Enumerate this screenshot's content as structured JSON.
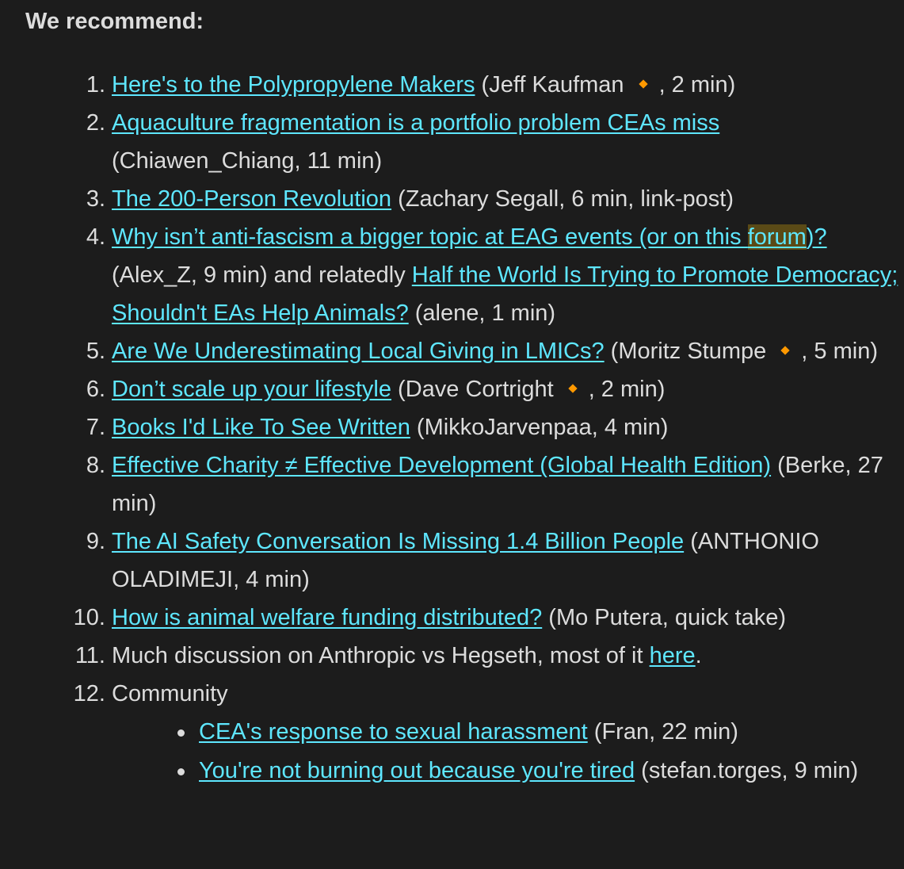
{
  "heading": "We recommend:",
  "items": [
    {
      "num": "1.",
      "title": "Here's to the Polypropylene Makers",
      "author": "Jeff Kaufman",
      "after": ", 2 min)"
    },
    {
      "num": "2.",
      "title": "Aquaculture fragmentation is a portfolio problem CEAs miss",
      "meta": "(Chiawen_Chiang, 11 min)"
    },
    {
      "num": "3.",
      "title": "The 200-Person Revolution",
      "meta": "(Zachary Segall, 6 min, link-post)"
    },
    {
      "num": "4.",
      "title_a": "Why isn’t anti-fascism a bigger topic at EAG events (or on this ",
      "title_hl": "forum",
      "title_b": ")?",
      "meta": "(Alex_Z, 9 min) and relatedly",
      "title2": "Half the World Is Trying to Promote Democracy; Shouldn't EAs Help Animals?",
      "meta2": "(alene, 1 min)"
    },
    {
      "num": "5.",
      "title": "Are We Underestimating Local Giving in LMICs?",
      "author": "Moritz Stumpe",
      "after": ", 5 min)"
    },
    {
      "num": "6.",
      "title": "Don’t scale up your lifestyle",
      "author": "Dave Cortright",
      "after": ", 2 min)"
    },
    {
      "num": "7.",
      "title": "Books I'd Like To See Written",
      "meta": "(MikkoJarvenpaa, 4 min)"
    },
    {
      "num": "8.",
      "title": "Effective Charity ≠ Effective Development (Global Health Edition)",
      "meta": "(Berke, 27 min)"
    },
    {
      "num": "9.",
      "title": "The AI Safety Conversation Is Missing 1.4 Billion People",
      "meta": "(ANTHONIO OLADIMEJI, 4 min)"
    },
    {
      "num": "10.",
      "title": "How is animal welfare funding distributed?",
      "meta": "(Mo Putera, quick take)"
    },
    {
      "num": "11.",
      "text": "Much discussion on Anthropic vs Hegseth, most of it",
      "link": "here",
      "after": "."
    },
    {
      "num": "12.",
      "text": "Community"
    }
  ],
  "community": [
    {
      "title": "CEA's response to sexual harassment",
      "meta": "(Fran, 22 min)"
    },
    {
      "title": "You're not burning out because you're tired",
      "meta": "(stefan.torges, 9 min)"
    }
  ],
  "colors": {
    "background": "#1c1c1c",
    "text": "#dcdcdc",
    "link": "#5ee7ff",
    "badge": "#ff9900",
    "highlight": "#5a4a16"
  }
}
